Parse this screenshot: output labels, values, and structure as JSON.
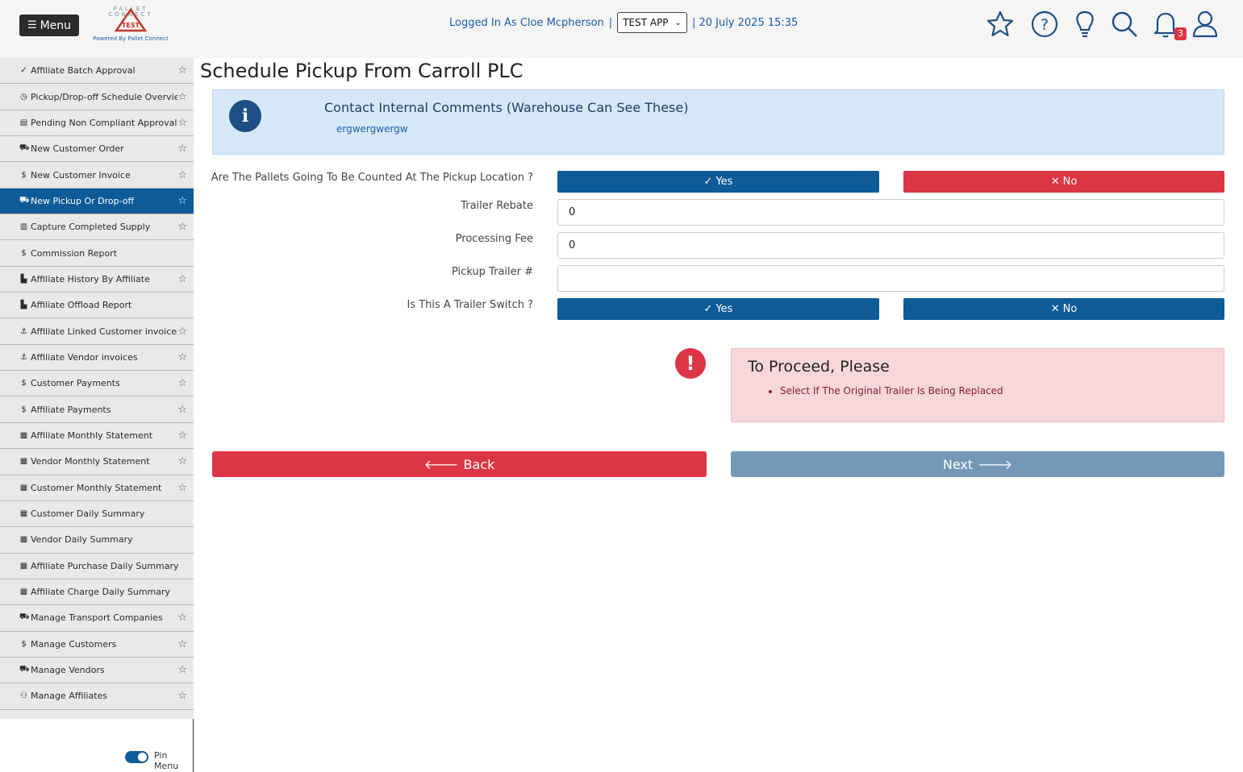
{
  "header": {
    "menu_label": "Menu",
    "logo_tiny_line1": "PALLET",
    "logo_tiny_line2": "CONNECT",
    "logo_badge": "TEST",
    "powered_by": "Powered By Pallet Connect",
    "logged_in_text": "Logged In As Cloe Mcpherson",
    "separator": "|",
    "app_select_value": "TEST APP",
    "datetime": "| 20 July 2025 15:35",
    "notification_count": "3",
    "icons": [
      "star-icon",
      "help-icon",
      "lightbulb-icon",
      "search-icon",
      "bell-icon",
      "user-icon"
    ]
  },
  "sidebar": {
    "items": [
      {
        "glyph": "✓",
        "label": "Affiliate Batch Approval",
        "starred": true
      },
      {
        "glyph": "◷",
        "label": "Pickup/Drop-off Schedule Overview",
        "starred": true
      },
      {
        "glyph": "▤",
        "label": "Pending Non Compliant Approvals",
        "starred": true
      },
      {
        "glyph": "⛟",
        "label": "New Customer Order",
        "starred": true
      },
      {
        "glyph": "$",
        "label": "New Customer Invoice",
        "starred": true
      },
      {
        "glyph": "⛟",
        "label": "New Pickup Or Drop-off",
        "starred": true,
        "active": true
      },
      {
        "glyph": "▥",
        "label": "Capture Completed Supply",
        "starred": true
      },
      {
        "glyph": "$",
        "label": "Commission Report",
        "starred": false
      },
      {
        "glyph": "▙",
        "label": "Affiliate History By Affiliate",
        "starred": true
      },
      {
        "glyph": "▙",
        "label": "Affiliate Offload Report",
        "starred": false
      },
      {
        "glyph": "⚓",
        "label": "Affiliate Linked Customer invoices",
        "starred": true
      },
      {
        "glyph": "⚓",
        "label": "Affiliate Vendor invoices",
        "starred": true
      },
      {
        "glyph": "$",
        "label": "Customer Payments",
        "starred": true
      },
      {
        "glyph": "$",
        "label": "Affiliate Payments",
        "starred": true
      },
      {
        "glyph": "▦",
        "label": "Affiliate Monthly Statement",
        "starred": true
      },
      {
        "glyph": "▦",
        "label": "Vendor Monthly Statement",
        "starred": true
      },
      {
        "glyph": "▦",
        "label": "Customer Monthly Statement",
        "starred": true
      },
      {
        "glyph": "▦",
        "label": "Customer Daily Summary",
        "starred": false
      },
      {
        "glyph": "▦",
        "label": "Vendor Daily Summary",
        "starred": false
      },
      {
        "glyph": "▦",
        "label": "Affiliate Purchase Daily Summary",
        "starred": false
      },
      {
        "glyph": "▦",
        "label": "Affiliate Charge Daily Summary",
        "starred": false
      },
      {
        "glyph": "⛟",
        "label": "Manage Transport Companies",
        "starred": true
      },
      {
        "glyph": "$",
        "label": "Manage Customers",
        "starred": true
      },
      {
        "glyph": "⛟",
        "label": "Manage Vendors",
        "starred": true
      },
      {
        "glyph": "⚇",
        "label": "Manage Affiliates",
        "starred": true
      }
    ],
    "pin_menu_label": "Pin Menu",
    "pin_menu_on": true
  },
  "main": {
    "title": "Schedule Pickup From Carroll PLC",
    "info": {
      "heading": "Contact Internal Comments (Warehouse Can See These)",
      "text": "ergwergwergw"
    },
    "form": {
      "pallets_counted_label": "Are The Pallets Going To Be Counted At The Pickup Location ?",
      "yes_label": "Yes",
      "no_label": "No",
      "trailer_rebate_label": "Trailer Rebate",
      "trailer_rebate_value": "0",
      "processing_fee_label": "Processing Fee",
      "processing_fee_value": "0",
      "pickup_trailer_label": "Pickup Trailer #",
      "pickup_trailer_value": "",
      "trailer_switch_label": "Is This A Trailer Switch ?"
    },
    "alert": {
      "title": "To Proceed, Please",
      "items": [
        "Select If The Original Trailer Is Being Replaced"
      ]
    },
    "back_label": "Back",
    "next_label": "Next",
    "colors": {
      "primary": "#0e5b98",
      "danger": "#dc3545",
      "disabled_next": "#7598b8",
      "info_bg": "#d6e8f8",
      "alert_bg": "#f8d7da"
    }
  }
}
